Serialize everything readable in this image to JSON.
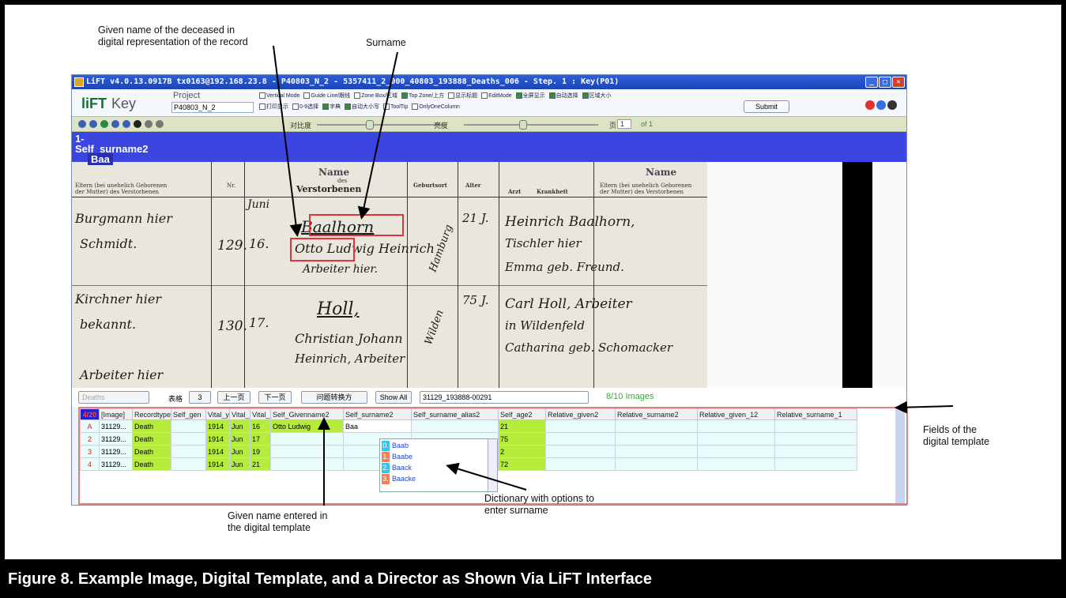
{
  "annotations": {
    "given_name_record_line1": "Given name of the deceased in",
    "given_name_record_line2": "digital representation of the record",
    "surname": "Surname",
    "fields_line1": "Fields of the",
    "fields_line2": "digital template",
    "given_entered_line1": "Given name entered in",
    "given_entered_line2": "the digital template",
    "dictionary_line1": "Dictionary with options to",
    "dictionary_line2": "enter surname"
  },
  "caption": "Figure 8.  Example Image, Digital Template, and a Director as Shown Via LiFT Interface",
  "window": {
    "title": "LiFT v4.0.13.0917B tx0163@192.168.23.8 - P40803_N_2 - 5357411_2_000_40803_193888_Deaths_006 - Step. 1 : Key(P01)",
    "logo_main": "liFT",
    "logo_mode": "Key",
    "project_label": "Project",
    "project_value": "P40803_N_2",
    "checkbox_row1": [
      "Vertical Mode",
      "Guide Line/跟线",
      "Zone Box/区域",
      "Top Zone/上方",
      "显示标题",
      "EditMode",
      "全屏显示",
      "自动选择",
      "区域大小"
    ],
    "checkbox_row2": [
      "打印显示",
      "0-9选择",
      "字典",
      "自动大小写",
      "ToolTip",
      "OnlyOneColumn"
    ],
    "submit": "Submit",
    "slider1_label": "对比度",
    "slider2_label": "亮度",
    "page_label": "页",
    "page_value": "1",
    "page_of": "of 1"
  },
  "viewer": {
    "overlay_line1": "1-",
    "overlay_line2": "Self_surname2",
    "overlay_value": "Baa",
    "header_left_1": "Eltern (bei unehelich Geborenen",
    "header_left_2": "der Mutter) des Verstorbenen",
    "header_nr": "Nr.",
    "header_verstorbenen": "Verstorbenen",
    "header_des": "des",
    "header_name": "Name",
    "header_geburtsort": "Geburtsort",
    "header_alter": "Alter",
    "header_arzt": "Arzt",
    "header_krankheit": "Krankheit",
    "header_right_1": "Eltern (bei unehelich Geborenen",
    "header_right_2": "der Mutter) des Verstorbenen",
    "hw_left1": "Burgmann hier",
    "hw_left2": "Schmidt.",
    "hw_left3": "Kirchner hier",
    "hw_left4": "bekannt.",
    "hw_left5": "Arbeiter hier",
    "hw_nr1": "129.",
    "hw_day1": "16.",
    "hw_month1": "Juni",
    "hw_surname1": "Baalhorn",
    "hw_given1": "Otto Ludwig Heinrich",
    "hw_occ1": "Arbeiter hier.",
    "hw_place1": "Hamburg",
    "hw_age1": "21 J.",
    "hw_parent1a": "Heinrich Baalhorn,",
    "hw_parent1b": "Tischler hier",
    "hw_parent1c": "Emma geb. Freund.",
    "hw_nr2": "130.",
    "hw_day2": "17.",
    "hw_surname2": "Holl,",
    "hw_given2": "Christian Johann",
    "hw_given2b": "Heinrich, Arbeiter",
    "hw_place2": "Wilden",
    "hw_age2": "75 J.",
    "hw_parent2a": "Carl Holl, Arbeiter",
    "hw_parent2b": "in Wildenfeld",
    "hw_parent2c": "Catharina geb. Schomacker"
  },
  "controls": {
    "record_type": "Deaths",
    "table_label": "表格",
    "table_value": "3",
    "prev_page": "上一页",
    "next_page": "下一页",
    "problem_button": "问题转换方",
    "show_all": "Show All",
    "image_select": "31129_193888-00291",
    "image_count": "8/10 Images"
  },
  "grid": {
    "counter": "4/20",
    "columns": [
      "[Image]",
      "Recordtype",
      "Self_gen",
      "Vital_y",
      "Vital_",
      "Vital_",
      "Self_Givenname2",
      "Self_surname2",
      "Self_surname_alias2",
      "Self_age2",
      "Relative_given2",
      "Relative_surname2",
      "Relative_given_12",
      "Relative_surname_1"
    ],
    "rows": [
      {
        "n": "A",
        "image": "31129...",
        "type": "Death",
        "gen": "",
        "year": "1914",
        "month": "Jun",
        "day": "16",
        "given": "Otto Ludwig",
        "surname": "Baa",
        "alias": "",
        "age": "21"
      },
      {
        "n": "2",
        "image": "31129...",
        "type": "Death",
        "gen": "",
        "year": "1914",
        "month": "Jun",
        "day": "17",
        "given": "",
        "surname": "",
        "alias": "",
        "age": "75"
      },
      {
        "n": "3",
        "image": "31129...",
        "type": "Death",
        "gen": "",
        "year": "1914",
        "month": "Jun",
        "day": "19",
        "given": "",
        "surname": "",
        "alias": "",
        "age": "2"
      },
      {
        "n": "4",
        "image": "31129...",
        "type": "Death",
        "gen": "",
        "year": "1914",
        "month": "Jun",
        "day": "21",
        "given": "",
        "surname": "",
        "alias": "",
        "age": "72"
      }
    ],
    "dictionary": [
      {
        "key": "0.",
        "value": "Baab",
        "color": "#33c6e8"
      },
      {
        "key": "1.",
        "value": "Baabe",
        "color": "#f0805a"
      },
      {
        "key": "2.",
        "value": "Baack",
        "color": "#33c6e8"
      },
      {
        "key": "3.",
        "value": "Baacke",
        "color": "#f0805a"
      }
    ]
  }
}
